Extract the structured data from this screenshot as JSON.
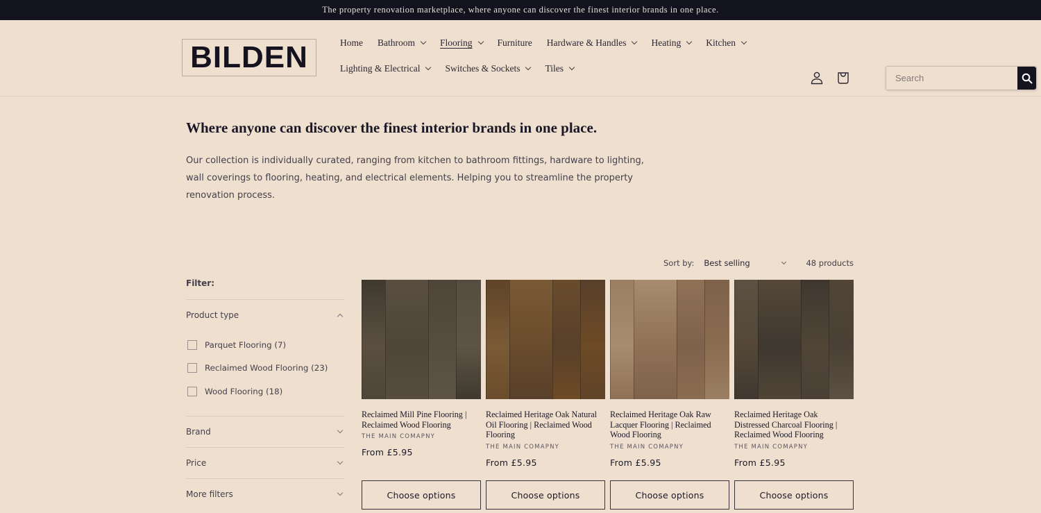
{
  "announcement": "The property renovation marketplace, where anyone can discover the finest interior brands in one place.",
  "header": {
    "logo": "BILDEN",
    "nav": [
      {
        "label": "Home",
        "dropdown": false,
        "active": false
      },
      {
        "label": "Bathroom",
        "dropdown": true,
        "active": false
      },
      {
        "label": "Flooring",
        "dropdown": true,
        "active": true
      },
      {
        "label": "Furniture",
        "dropdown": false,
        "active": false
      },
      {
        "label": "Hardware & Handles",
        "dropdown": true,
        "active": false
      },
      {
        "label": "Heating",
        "dropdown": true,
        "active": false
      },
      {
        "label": "Kitchen",
        "dropdown": true,
        "active": false
      },
      {
        "label": "Lighting & Electrical",
        "dropdown": true,
        "active": false
      },
      {
        "label": "Switches & Sockets",
        "dropdown": true,
        "active": false
      },
      {
        "label": "Tiles",
        "dropdown": true,
        "active": false
      }
    ],
    "account_icon": "user-icon",
    "cart_icon": "shopping-bag-icon",
    "search": {
      "placeholder": "Search",
      "value": "",
      "button_icon": "search-icon"
    }
  },
  "hero": {
    "title": "Where anyone can discover the finest interior brands in one place.",
    "description": "Our collection is individually curated, ranging from kitchen to bathroom fittings, hardware to lighting, wall coverings to flooring, heating, and electrical elements. Helping you to streamline the property renovation process."
  },
  "sort": {
    "label": "Sort by:",
    "selected": "Best selling",
    "product_count": "48 products"
  },
  "filters": {
    "title": "Filter:",
    "product_type": {
      "label": "Product type",
      "expanded": true,
      "options": [
        {
          "label": "Parquet Flooring (7)",
          "checked": false
        },
        {
          "label": "Reclaimed Wood Flooring (23)",
          "checked": false
        },
        {
          "label": "Wood Flooring (18)",
          "checked": false
        }
      ]
    },
    "groups": [
      {
        "label": "Brand"
      },
      {
        "label": "Price"
      },
      {
        "label": "More filters"
      }
    ]
  },
  "products": [
    {
      "title": "Reclaimed Mill Pine Flooring | Reclaimed Wood Flooring",
      "vendor": "THE MAIN COMAPNY",
      "price": "From £5.95",
      "button": "Choose options",
      "colors": [
        "#5e5446",
        "#3f392f",
        "#5a4f41",
        "#4e4638",
        "#564c3f"
      ]
    },
    {
      "title": "Reclaimed Heritage Oak Natural Oil Flooring | Reclaimed Wood Flooring",
      "vendor": "THE MAIN COMAPNY",
      "price": "From £5.95",
      "button": "Choose options",
      "colors": [
        "#6e4a26",
        "#5f4428",
        "#7b5a36",
        "#6a4c2c",
        "#58402a"
      ]
    },
    {
      "title": "Reclaimed Heritage Oak Raw Lacquer Flooring | Reclaimed Wood Flooring",
      "vendor": "THE MAIN COMAPNY",
      "price": "From £5.95",
      "button": "Choose options",
      "colors": [
        "#8a6c50",
        "#9b7f62",
        "#a88c6e",
        "#8f7256",
        "#7e624a"
      ]
    },
    {
      "title": "Reclaimed Heritage Oak Distressed Charcoal Flooring | Reclaimed Wood Flooring",
      "vendor": "THE MAIN COMAPNY",
      "price": "From £5.95",
      "button": "Choose options",
      "colors": [
        "#4a4035",
        "#5c5142",
        "#554838",
        "#3f3830",
        "#504536"
      ]
    }
  ]
}
